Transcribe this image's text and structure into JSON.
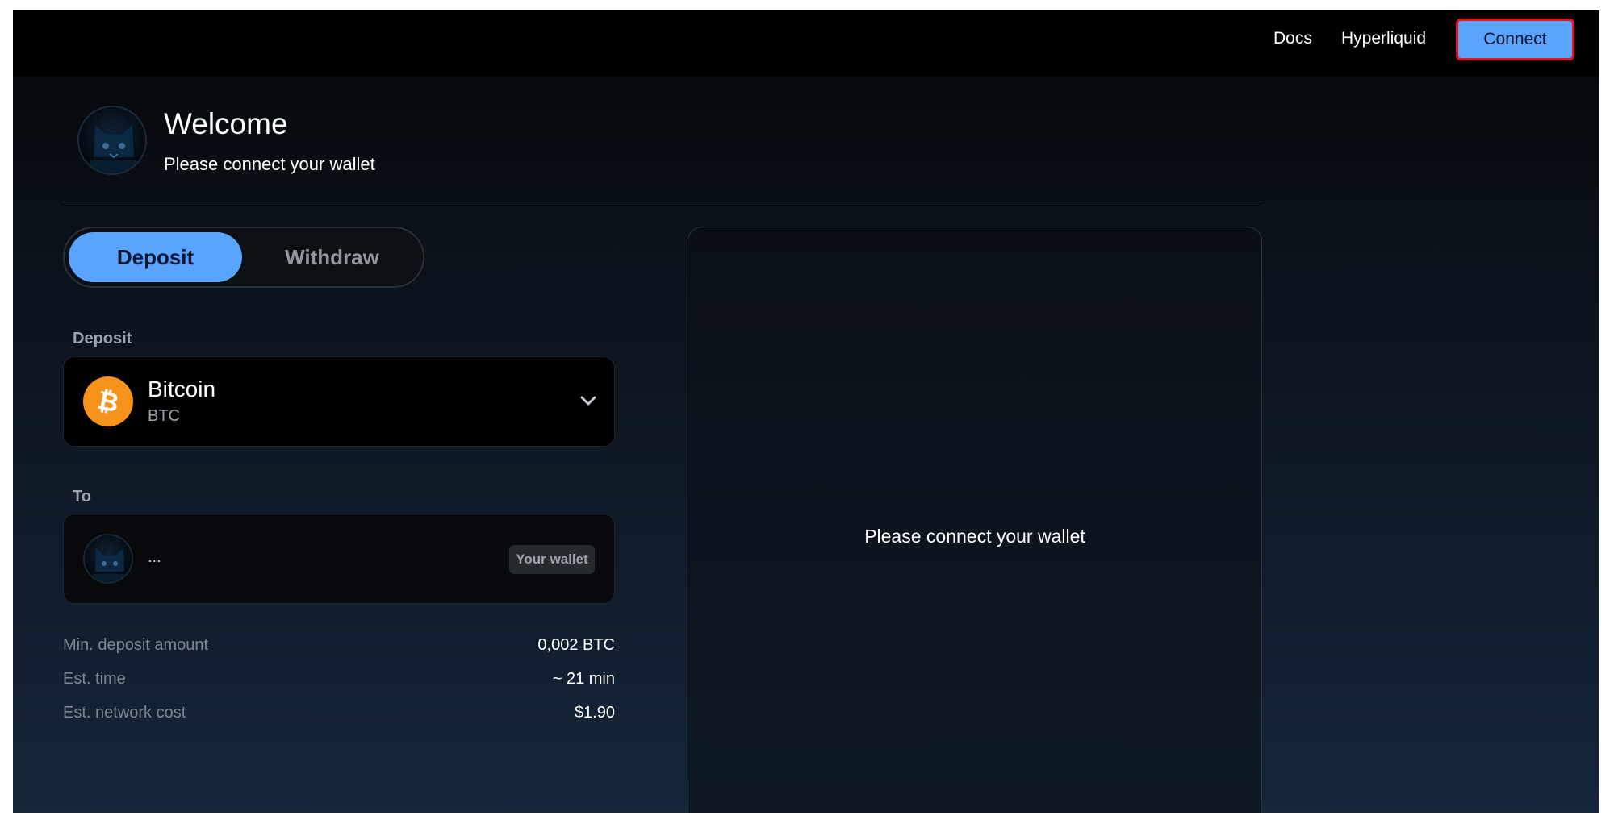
{
  "nav": {
    "docs": "Docs",
    "hyperliquid": "Hyperliquid",
    "connect": "Connect"
  },
  "header": {
    "title": "Welcome",
    "subtitle": "Please connect your wallet"
  },
  "tabs": {
    "deposit": "Deposit",
    "withdraw": "Withdraw",
    "active": "Deposit"
  },
  "form": {
    "deposit_label": "Deposit",
    "asset": {
      "name": "Bitcoin",
      "symbol": "BTC",
      "icon": "bitcoin-icon"
    },
    "to_label": "To",
    "to_address": "...",
    "wallet_badge": "Your wallet"
  },
  "info": [
    {
      "label": "Min. deposit amount",
      "value": "0,002 BTC"
    },
    {
      "label": "Est. time",
      "value": "~ 21 min"
    },
    {
      "label": "Est. network cost",
      "value": "$1.90"
    }
  ],
  "panel": {
    "message": "Please connect your wallet"
  },
  "colors": {
    "accent": "#5aa3ff",
    "bitcoin": "#f7931a",
    "highlight_border": "#e8131b"
  }
}
